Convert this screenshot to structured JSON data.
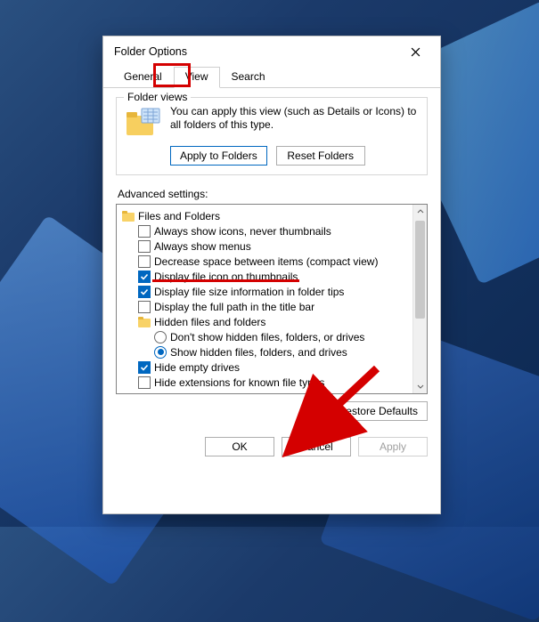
{
  "window": {
    "title": "Folder Options"
  },
  "tabs": {
    "general": "General",
    "view": "View",
    "search": "Search"
  },
  "folder_views": {
    "legend": "Folder views",
    "description": "You can apply this view (such as Details or Icons) to all folders of this type.",
    "apply_btn": "Apply to Folders",
    "reset_btn": "Reset Folders"
  },
  "advanced": {
    "label": "Advanced settings:",
    "root": "Files and Folders",
    "items": [
      {
        "type": "checkbox",
        "checked": false,
        "label": "Always show icons, never thumbnails"
      },
      {
        "type": "checkbox",
        "checked": false,
        "label": "Always show menus"
      },
      {
        "type": "checkbox",
        "checked": false,
        "label": "Decrease space between items (compact view)"
      },
      {
        "type": "checkbox",
        "checked": true,
        "label": "Display file icon on thumbnails"
      },
      {
        "type": "checkbox",
        "checked": true,
        "label": "Display file size information in folder tips"
      },
      {
        "type": "checkbox",
        "checked": false,
        "label": "Display the full path in the title bar"
      }
    ],
    "hidden_group": {
      "label": "Hidden files and folders",
      "options": [
        {
          "checked": false,
          "label": "Don't show hidden files, folders, or drives"
        },
        {
          "checked": true,
          "label": "Show hidden files, folders, and drives"
        }
      ]
    },
    "trailing": [
      {
        "type": "checkbox",
        "checked": true,
        "label": "Hide empty drives"
      },
      {
        "type": "checkbox",
        "checked": false,
        "label": "Hide extensions for known file types"
      }
    ],
    "restore_btn": "Restore Defaults"
  },
  "footer": {
    "ok": "OK",
    "cancel": "Cancel",
    "apply": "Apply"
  }
}
